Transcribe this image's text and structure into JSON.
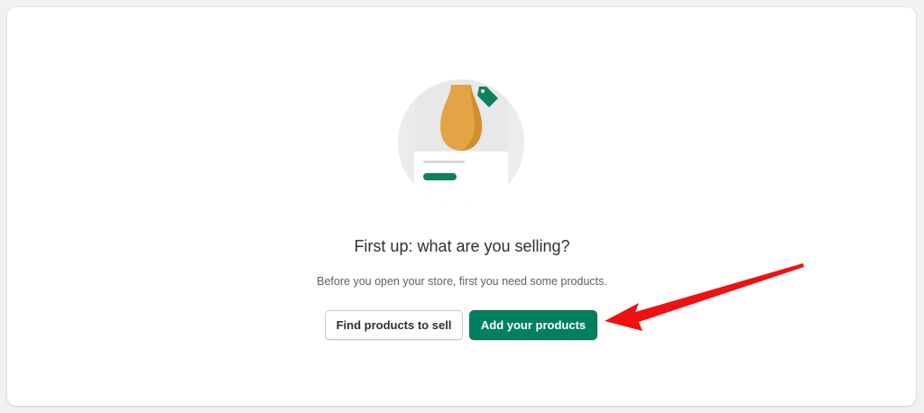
{
  "empty_state": {
    "title": "First up: what are you selling?",
    "subtitle": "Before you open your store, first you need some products."
  },
  "actions": {
    "secondary_label": "Find products to sell",
    "primary_label": "Add your products"
  },
  "colors": {
    "primary": "#008060",
    "annotation_arrow": "#ee1111",
    "vase": "#e2a444"
  },
  "icons": {
    "illustration": "product-card-vase-illustration",
    "tag": "price-tag-icon",
    "annotation": "red-arrow-annotation"
  }
}
